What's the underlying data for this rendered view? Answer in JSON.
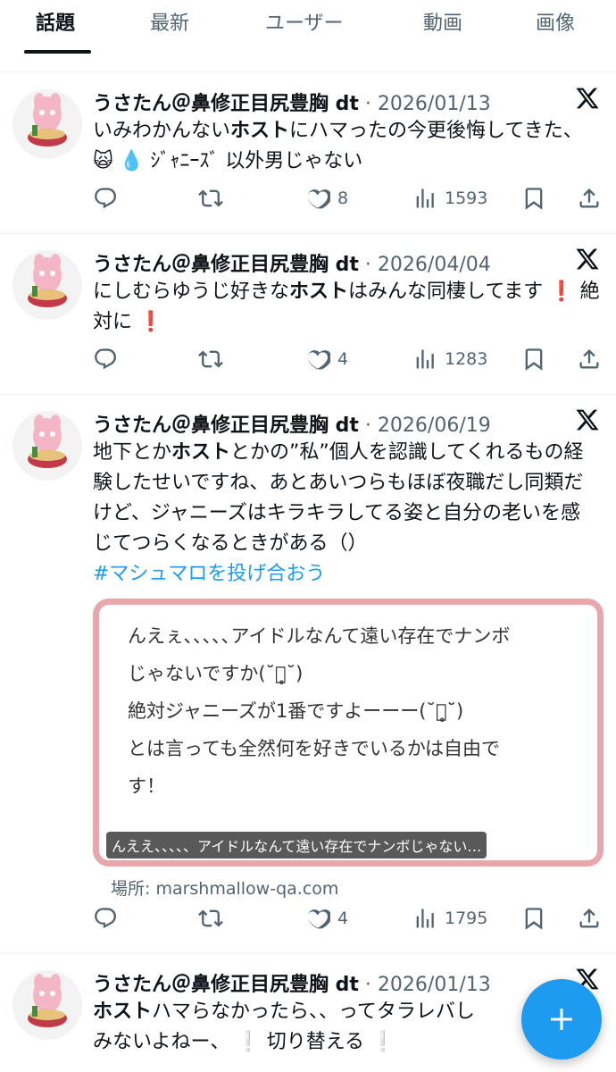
{
  "tabs": [
    "話題",
    "最新",
    "ユーザー",
    "動画",
    "画像"
  ],
  "posts": [
    {
      "name": "うさたん＠鼻修正目尻豊胸 dt",
      "date": "2026/01/13",
      "text_parts": [
        "いみわかんない",
        "ホスト",
        "にハマったの今更後悔してきた、 🙀 💧 ｼﾞｬﾆｰｽﾞ 以外男じゃない"
      ],
      "likes": "8",
      "views": "1593"
    },
    {
      "name": "うさたん＠鼻修正目尻豊胸 dt",
      "date": "2026/04/04",
      "text_parts": [
        "にしむらゆうじ好きな",
        "ホスト",
        "はみんな同棲してます ❗️ 絶対に ❗️"
      ],
      "likes": "4",
      "views": "1283"
    },
    {
      "name": "うさたん＠鼻修正目尻豊胸 dt",
      "date": "2026/06/19",
      "text_parts": [
        "地下とか",
        "ホスト",
        "とかの”私”個人を認識してくれるもの経験したせいですね、あとあいつらもほぼ夜職だし同類だけど、ジャニーズはキラキラしてる姿と自分の老いを感じてつらくなるときがある（）"
      ],
      "hashtag": "#マシュマロを投げ合おう",
      "card": {
        "lines": [
          "んえぇ､､､､､アイドルなんて遠い存在でナンボ",
          "じゃないですか(˘･̥˘)",
          "絶対ジャニーズが1番ですよーーー(˘･̥˘)",
          "とは言っても全然何を好きでいるかは自由で",
          "す！"
        ],
        "caption": "んええ、、、、、アイドルなんて遠い存在でナンボじゃない…"
      },
      "source": "場所: marshmallow-qa.com",
      "likes": "4",
      "views": "1795"
    },
    {
      "name": "うさたん＠鼻修正目尻豊胸 dt",
      "date": "2026/01/13",
      "text_parts": [
        "ホスト",
        "ハマらなかったら、、ってタラレバし",
        "みないよねー、 ❕ 切り替える ❕"
      ]
    }
  ]
}
